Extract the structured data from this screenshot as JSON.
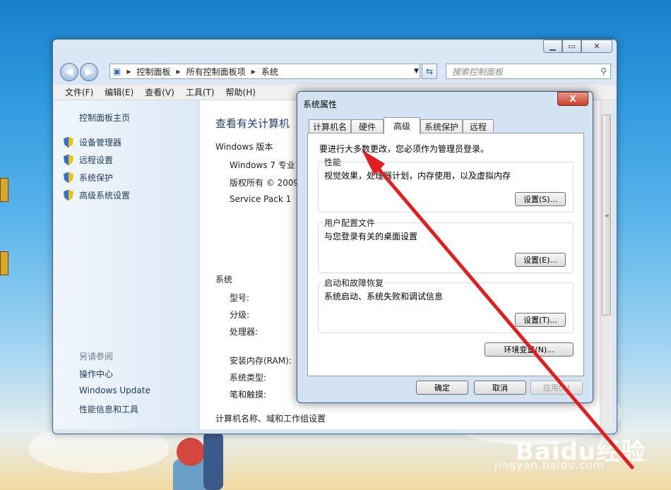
{
  "main_window": {
    "address_path": [
      "控制面板",
      "所有控制面板项",
      "系统"
    ],
    "search_placeholder": "搜索控制面板",
    "menu": [
      "文件(F)",
      "编辑(E)",
      "查看(V)",
      "工具(T)",
      "帮助(H)"
    ],
    "left_pane": {
      "home_link": "控制面板主页",
      "tasks": [
        "设备管理器",
        "远程设置",
        "系统保护",
        "高级系统设置"
      ],
      "see_also_header": "另请参阅",
      "see_also": [
        "操作中心",
        "Windows Update",
        "性能信息和工具"
      ]
    },
    "content": {
      "title": "查看有关计算机",
      "edition_header": "Windows 版本",
      "edition": "Windows 7 专业",
      "copyright": "版权所有 © 2009",
      "service_pack": "Service Pack 1",
      "system_header": "系统",
      "model_label": "型号:",
      "rating_label": "分级:",
      "processor_label": "处理器:",
      "ram_label": "安装内存(RAM):",
      "system_type_label": "系统类型:",
      "pen_touch_label": "笔和触摸:",
      "computer_name_header": "计算机名称、域和工作组设置"
    }
  },
  "dialog": {
    "title": "系统属性",
    "close_label": "X",
    "tabs": [
      "计算机名",
      "硬件",
      "高级",
      "系统保护",
      "远程"
    ],
    "active_tab": "高级",
    "admin_note": "要进行大多数更改，您必须作为管理员登录。",
    "performance": {
      "label": "性能",
      "desc": "视觉效果，处理器计划，内存使用，以及虚拟内存",
      "button": "设置(S)..."
    },
    "user_profiles": {
      "label": "用户配置文件",
      "desc": "与您登录有关的桌面设置",
      "button": "设置(E)..."
    },
    "startup": {
      "label": "启动和故障恢复",
      "desc": "系统启动、系统失败和调试信息",
      "button": "设置(T)..."
    },
    "env_button": "环境变量(N)...",
    "ok": "确定",
    "cancel": "取消",
    "apply": "应用(A)"
  },
  "watermark": {
    "brand": "Baidu经验",
    "url": "jingyan.baidu.com"
  },
  "annotation_color": "#e41e1e"
}
